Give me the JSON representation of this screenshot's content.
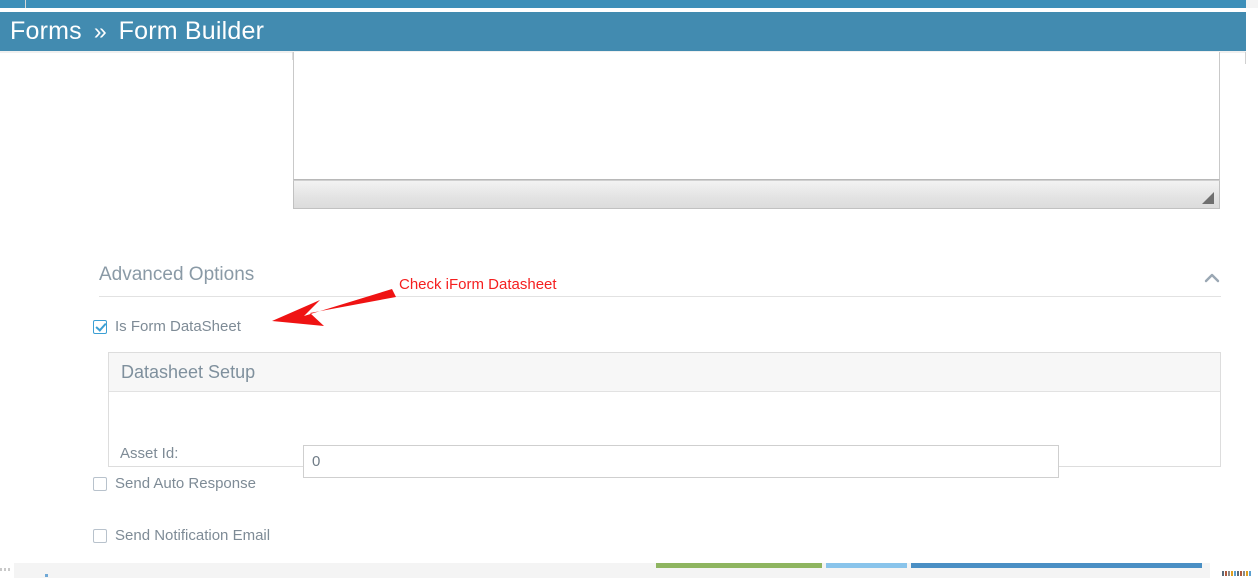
{
  "header": {
    "breadcrumb": {
      "root": "Forms",
      "separator": "»",
      "current": "Form Builder"
    },
    "bar_color": "#428bb0"
  },
  "editor": {
    "content": "",
    "resize_grip_icon": "resize-grip-icon"
  },
  "advanced_options": {
    "title": "Advanced Options",
    "collapse_icon": "chevron-up-icon",
    "is_form_datasheet": {
      "label": "Is Form DataSheet",
      "checked": true
    },
    "send_auto_response": {
      "label": "Send Auto Response",
      "checked": false
    },
    "send_notification_email": {
      "label": "Send Notification Email",
      "checked": false
    }
  },
  "datasheet_setup": {
    "panel_title": "Datasheet Setup",
    "asset_id": {
      "label": "Asset Id:",
      "value": "0",
      "placeholder": ""
    }
  },
  "footer_buttons": [
    {
      "name": "primary-green-button",
      "color": "#8eb560"
    },
    {
      "name": "secondary-light-blue-button",
      "color": "#89c4eb"
    },
    {
      "name": "tertiary-blue-button",
      "color": "#4a8fc4"
    }
  ],
  "annotation": {
    "text": "Check iForm Datasheet",
    "color": "#f51f1f",
    "arrow_icon": "arrow-left-icon"
  }
}
